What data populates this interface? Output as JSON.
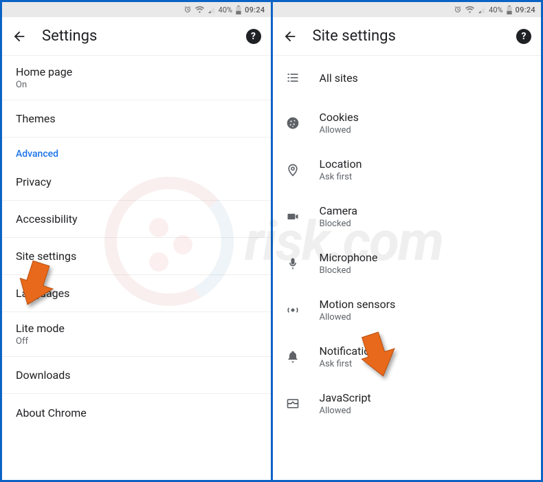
{
  "status": {
    "battery": "40%",
    "time": "09:24"
  },
  "left": {
    "title": "Settings",
    "items": [
      {
        "label": "Home page",
        "sub": "On"
      },
      {
        "label": "Themes"
      }
    ],
    "section": "Advanced",
    "adv_items": [
      {
        "label": "Privacy"
      },
      {
        "label": "Accessibility"
      },
      {
        "label": "Site settings"
      },
      {
        "label": "Languages"
      },
      {
        "label": "Lite mode",
        "sub": "Off"
      },
      {
        "label": "Downloads"
      },
      {
        "label": "About Chrome"
      }
    ]
  },
  "right": {
    "title": "Site settings",
    "items": [
      {
        "icon": "list-icon",
        "label": "All sites"
      },
      {
        "icon": "cookie-icon",
        "label": "Cookies",
        "sub": "Allowed"
      },
      {
        "icon": "location-icon",
        "label": "Location",
        "sub": "Ask first"
      },
      {
        "icon": "camera-icon",
        "label": "Camera",
        "sub": "Blocked"
      },
      {
        "icon": "microphone-icon",
        "label": "Microphone",
        "sub": "Blocked"
      },
      {
        "icon": "motion-icon",
        "label": "Motion sensors",
        "sub": "Allowed"
      },
      {
        "icon": "bell-icon",
        "label": "Notifications",
        "sub": "Ask first"
      },
      {
        "icon": "javascript-icon",
        "label": "JavaScript",
        "sub": "Allowed"
      }
    ]
  },
  "watermark": {
    "text": "risk.com"
  }
}
